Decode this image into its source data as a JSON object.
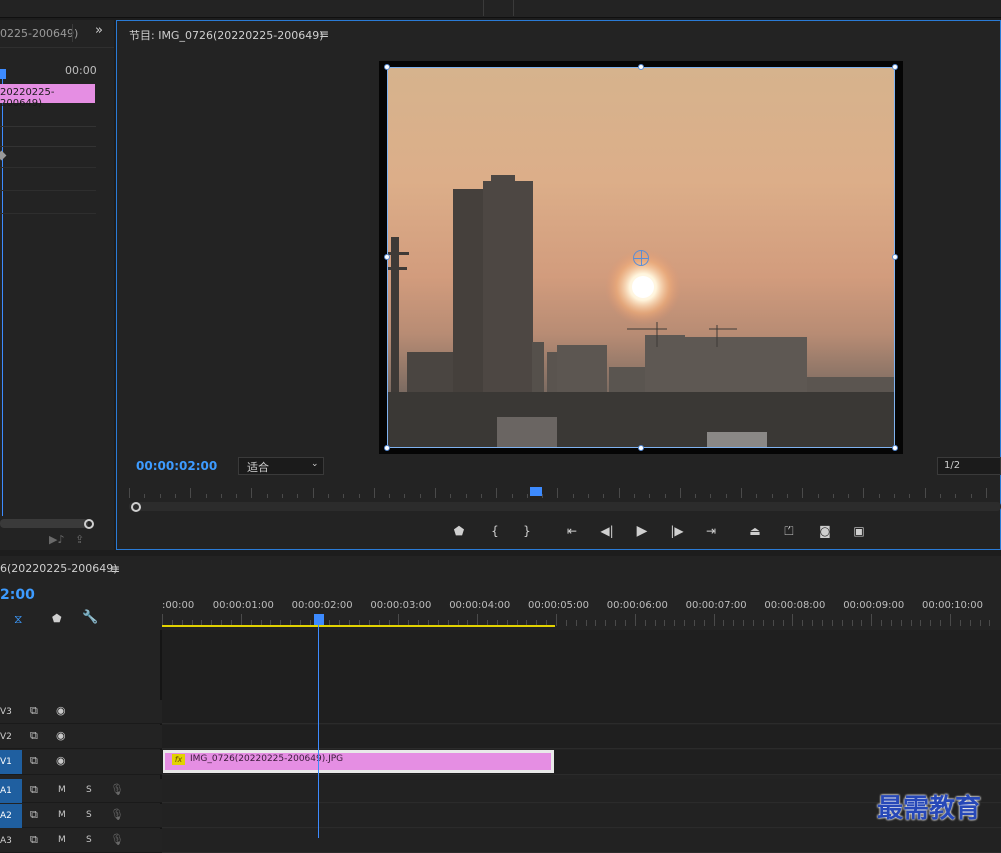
{
  "source_panel": {
    "clip_name_partial": "0225-200649)",
    "time_end": "00:00",
    "clip_label": "20220225-200649)"
  },
  "program_monitor": {
    "title": "节目: IMG_0726(20220225-200649)",
    "menu_icon": "menu-icon",
    "timecode": "00:00:02:00",
    "fit_select": "适合",
    "resolution": "1/2"
  },
  "timeline": {
    "sequence_name": "6(20220225-200649)",
    "timecode_partial": "2:00",
    "ruler_labels": [
      ":00:00",
      "00:00:01:00",
      "00:00:02:00",
      "00:00:03:00",
      "00:00:04:00",
      "00:00:05:00",
      "00:00:06:00",
      "00:00:07:00",
      "00:00:08:00",
      "00:00:09:00",
      "00:00:10:00"
    ],
    "tracks": [
      {
        "label": "V3",
        "active": false
      },
      {
        "label": "V2",
        "active": false
      },
      {
        "label": "V1",
        "active": true
      },
      {
        "label": "A1",
        "active": true
      },
      {
        "label": "A2",
        "active": true
      },
      {
        "label": "A3",
        "active": false
      }
    ],
    "mute_label": "M",
    "solo_label": "S",
    "clip": {
      "fx_badge": "fx",
      "name": "IMG_0726(20220225-200649).JPG",
      "color": "#e58ee3"
    }
  },
  "watermark": "最需教育",
  "colors": {
    "accent": "#2a7bd6",
    "timecode": "#3d9bff",
    "work_area": "#e2d300",
    "clip_pink": "#e58ee3"
  }
}
